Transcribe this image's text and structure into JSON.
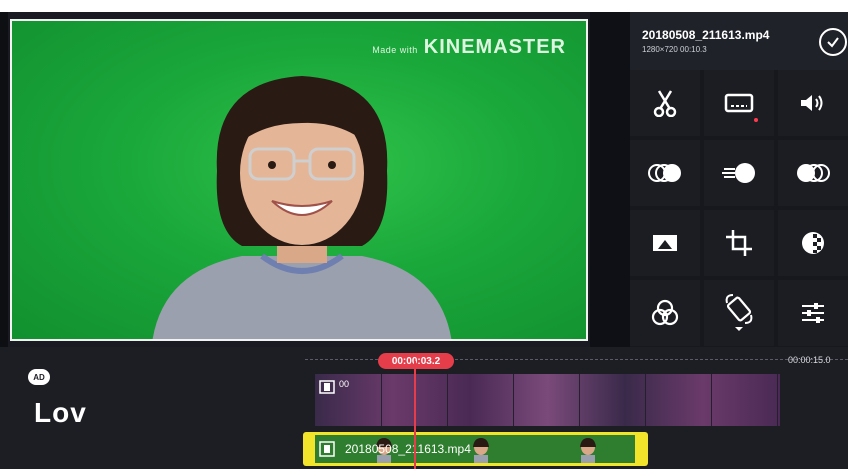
{
  "preview": {
    "watermark_small": "Made with",
    "watermark_big": "KINEMASTER"
  },
  "panel": {
    "file_name": "20180508_211613.mp4",
    "file_meta": "1280×720  00:10.3",
    "tools": [
      {
        "name": "trim-split",
        "icon": "scissors-icon"
      },
      {
        "name": "captions",
        "icon": "caption-box-icon"
      },
      {
        "name": "volume",
        "icon": "speaker-icon"
      },
      {
        "name": "chroma-key",
        "icon": "overlap-circles-icon"
      },
      {
        "name": "speed",
        "icon": "speed-ball-icon"
      },
      {
        "name": "color-blend",
        "icon": "blend-circles-icon"
      },
      {
        "name": "pan-zoom",
        "icon": "image-frame-icon"
      },
      {
        "name": "crop",
        "icon": "crop-icon"
      },
      {
        "name": "filter",
        "icon": "checker-circle-icon"
      },
      {
        "name": "color-adjust",
        "icon": "rgb-circles-icon"
      },
      {
        "name": "rotate-mirror",
        "icon": "rotate-icon"
      },
      {
        "name": "adjustments",
        "icon": "sliders-icon"
      }
    ],
    "colors": {
      "accent": "#e63d4b",
      "clip_border": "#f2e32b",
      "chroma": "#1aa83b"
    }
  },
  "timeline": {
    "ad_badge": "AD",
    "logo_text": "Lov",
    "playhead_time": "00:00:03.2",
    "end_time": "00:00:15.0",
    "overlay_clip_label": "00",
    "main_clip_label": "20180508_211613.mp4"
  }
}
